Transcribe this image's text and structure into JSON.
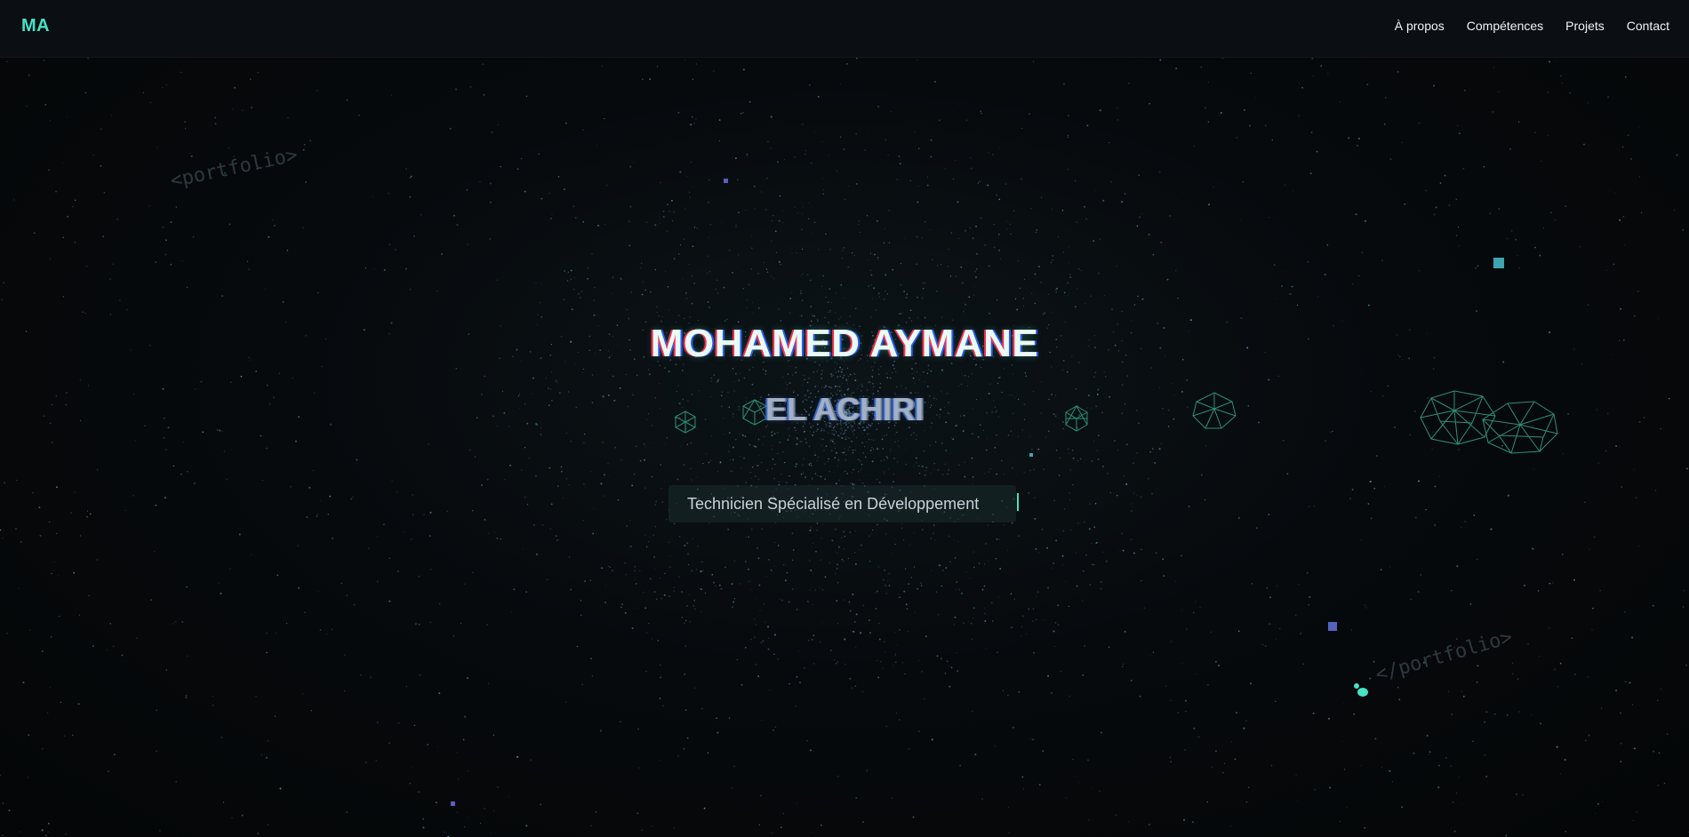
{
  "app": {
    "logo": "MA"
  },
  "nav": {
    "links": [
      {
        "label": "À propos"
      },
      {
        "label": "Compétences"
      },
      {
        "label": "Projets"
      },
      {
        "label": "Contact"
      }
    ]
  },
  "hero": {
    "first_name": "MOHAMED AYMANE",
    "last_name": "EL ACHIRI",
    "role": "Technicien Spécialisé en Développement"
  },
  "decor": {
    "open_tag": "<portfolio>",
    "close_tag": "</portfolio>"
  },
  "colors": {
    "accent": "#44e3c4",
    "background": "#050709",
    "navbar": "#0b0e13",
    "wireframe": "#2f8f74",
    "cube_teal": "#3ea6b0",
    "cube_indigo": "#5563c0"
  }
}
